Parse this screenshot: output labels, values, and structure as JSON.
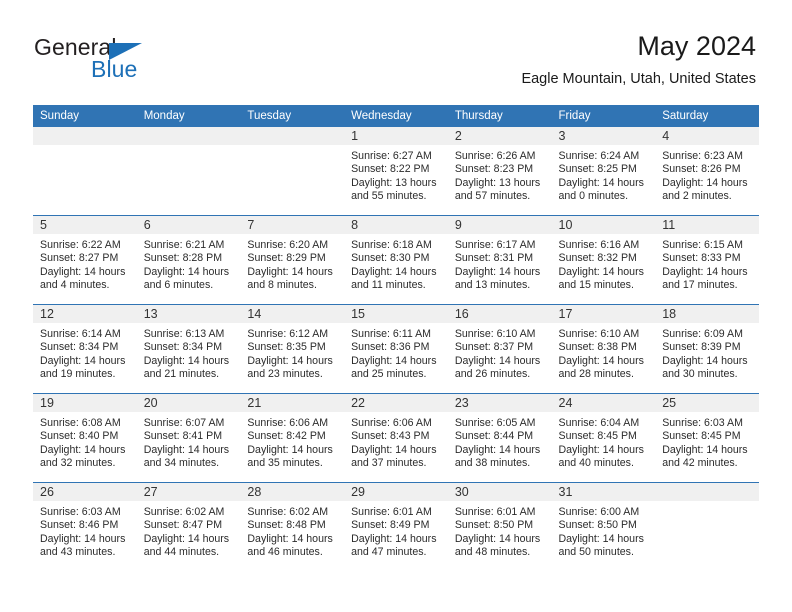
{
  "brand": {
    "name_top": "General",
    "name_bottom": "Blue",
    "triangle_color": "#1d70b7",
    "text_color": "#231f20"
  },
  "header": {
    "title": "May 2024",
    "subtitle": "Eagle Mountain, Utah, United States"
  },
  "theme": {
    "accent": "#3074b4",
    "daynum_band": "#f0f0f0",
    "cell_background": "#ffffff",
    "header_text": "#ffffff"
  },
  "calendar": {
    "weekday_headers": [
      "Sunday",
      "Monday",
      "Tuesday",
      "Wednesday",
      "Thursday",
      "Friday",
      "Saturday"
    ],
    "weeks": [
      [
        {
          "day": "",
          "sunrise": "",
          "sunset": "",
          "daylight_line1": "",
          "daylight_line2": ""
        },
        {
          "day": "",
          "sunrise": "",
          "sunset": "",
          "daylight_line1": "",
          "daylight_line2": ""
        },
        {
          "day": "",
          "sunrise": "",
          "sunset": "",
          "daylight_line1": "",
          "daylight_line2": ""
        },
        {
          "day": "1",
          "sunrise": "Sunrise: 6:27 AM",
          "sunset": "Sunset: 8:22 PM",
          "daylight_line1": "Daylight: 13 hours",
          "daylight_line2": "and 55 minutes."
        },
        {
          "day": "2",
          "sunrise": "Sunrise: 6:26 AM",
          "sunset": "Sunset: 8:23 PM",
          "daylight_line1": "Daylight: 13 hours",
          "daylight_line2": "and 57 minutes."
        },
        {
          "day": "3",
          "sunrise": "Sunrise: 6:24 AM",
          "sunset": "Sunset: 8:25 PM",
          "daylight_line1": "Daylight: 14 hours",
          "daylight_line2": "and 0 minutes."
        },
        {
          "day": "4",
          "sunrise": "Sunrise: 6:23 AM",
          "sunset": "Sunset: 8:26 PM",
          "daylight_line1": "Daylight: 14 hours",
          "daylight_line2": "and 2 minutes."
        }
      ],
      [
        {
          "day": "5",
          "sunrise": "Sunrise: 6:22 AM",
          "sunset": "Sunset: 8:27 PM",
          "daylight_line1": "Daylight: 14 hours",
          "daylight_line2": "and 4 minutes."
        },
        {
          "day": "6",
          "sunrise": "Sunrise: 6:21 AM",
          "sunset": "Sunset: 8:28 PM",
          "daylight_line1": "Daylight: 14 hours",
          "daylight_line2": "and 6 minutes."
        },
        {
          "day": "7",
          "sunrise": "Sunrise: 6:20 AM",
          "sunset": "Sunset: 8:29 PM",
          "daylight_line1": "Daylight: 14 hours",
          "daylight_line2": "and 8 minutes."
        },
        {
          "day": "8",
          "sunrise": "Sunrise: 6:18 AM",
          "sunset": "Sunset: 8:30 PM",
          "daylight_line1": "Daylight: 14 hours",
          "daylight_line2": "and 11 minutes."
        },
        {
          "day": "9",
          "sunrise": "Sunrise: 6:17 AM",
          "sunset": "Sunset: 8:31 PM",
          "daylight_line1": "Daylight: 14 hours",
          "daylight_line2": "and 13 minutes."
        },
        {
          "day": "10",
          "sunrise": "Sunrise: 6:16 AM",
          "sunset": "Sunset: 8:32 PM",
          "daylight_line1": "Daylight: 14 hours",
          "daylight_line2": "and 15 minutes."
        },
        {
          "day": "11",
          "sunrise": "Sunrise: 6:15 AM",
          "sunset": "Sunset: 8:33 PM",
          "daylight_line1": "Daylight: 14 hours",
          "daylight_line2": "and 17 minutes."
        }
      ],
      [
        {
          "day": "12",
          "sunrise": "Sunrise: 6:14 AM",
          "sunset": "Sunset: 8:34 PM",
          "daylight_line1": "Daylight: 14 hours",
          "daylight_line2": "and 19 minutes."
        },
        {
          "day": "13",
          "sunrise": "Sunrise: 6:13 AM",
          "sunset": "Sunset: 8:34 PM",
          "daylight_line1": "Daylight: 14 hours",
          "daylight_line2": "and 21 minutes."
        },
        {
          "day": "14",
          "sunrise": "Sunrise: 6:12 AM",
          "sunset": "Sunset: 8:35 PM",
          "daylight_line1": "Daylight: 14 hours",
          "daylight_line2": "and 23 minutes."
        },
        {
          "day": "15",
          "sunrise": "Sunrise: 6:11 AM",
          "sunset": "Sunset: 8:36 PM",
          "daylight_line1": "Daylight: 14 hours",
          "daylight_line2": "and 25 minutes."
        },
        {
          "day": "16",
          "sunrise": "Sunrise: 6:10 AM",
          "sunset": "Sunset: 8:37 PM",
          "daylight_line1": "Daylight: 14 hours",
          "daylight_line2": "and 26 minutes."
        },
        {
          "day": "17",
          "sunrise": "Sunrise: 6:10 AM",
          "sunset": "Sunset: 8:38 PM",
          "daylight_line1": "Daylight: 14 hours",
          "daylight_line2": "and 28 minutes."
        },
        {
          "day": "18",
          "sunrise": "Sunrise: 6:09 AM",
          "sunset": "Sunset: 8:39 PM",
          "daylight_line1": "Daylight: 14 hours",
          "daylight_line2": "and 30 minutes."
        }
      ],
      [
        {
          "day": "19",
          "sunrise": "Sunrise: 6:08 AM",
          "sunset": "Sunset: 8:40 PM",
          "daylight_line1": "Daylight: 14 hours",
          "daylight_line2": "and 32 minutes."
        },
        {
          "day": "20",
          "sunrise": "Sunrise: 6:07 AM",
          "sunset": "Sunset: 8:41 PM",
          "daylight_line1": "Daylight: 14 hours",
          "daylight_line2": "and 34 minutes."
        },
        {
          "day": "21",
          "sunrise": "Sunrise: 6:06 AM",
          "sunset": "Sunset: 8:42 PM",
          "daylight_line1": "Daylight: 14 hours",
          "daylight_line2": "and 35 minutes."
        },
        {
          "day": "22",
          "sunrise": "Sunrise: 6:06 AM",
          "sunset": "Sunset: 8:43 PM",
          "daylight_line1": "Daylight: 14 hours",
          "daylight_line2": "and 37 minutes."
        },
        {
          "day": "23",
          "sunrise": "Sunrise: 6:05 AM",
          "sunset": "Sunset: 8:44 PM",
          "daylight_line1": "Daylight: 14 hours",
          "daylight_line2": "and 38 minutes."
        },
        {
          "day": "24",
          "sunrise": "Sunrise: 6:04 AM",
          "sunset": "Sunset: 8:45 PM",
          "daylight_line1": "Daylight: 14 hours",
          "daylight_line2": "and 40 minutes."
        },
        {
          "day": "25",
          "sunrise": "Sunrise: 6:03 AM",
          "sunset": "Sunset: 8:45 PM",
          "daylight_line1": "Daylight: 14 hours",
          "daylight_line2": "and 42 minutes."
        }
      ],
      [
        {
          "day": "26",
          "sunrise": "Sunrise: 6:03 AM",
          "sunset": "Sunset: 8:46 PM",
          "daylight_line1": "Daylight: 14 hours",
          "daylight_line2": "and 43 minutes."
        },
        {
          "day": "27",
          "sunrise": "Sunrise: 6:02 AM",
          "sunset": "Sunset: 8:47 PM",
          "daylight_line1": "Daylight: 14 hours",
          "daylight_line2": "and 44 minutes."
        },
        {
          "day": "28",
          "sunrise": "Sunrise: 6:02 AM",
          "sunset": "Sunset: 8:48 PM",
          "daylight_line1": "Daylight: 14 hours",
          "daylight_line2": "and 46 minutes."
        },
        {
          "day": "29",
          "sunrise": "Sunrise: 6:01 AM",
          "sunset": "Sunset: 8:49 PM",
          "daylight_line1": "Daylight: 14 hours",
          "daylight_line2": "and 47 minutes."
        },
        {
          "day": "30",
          "sunrise": "Sunrise: 6:01 AM",
          "sunset": "Sunset: 8:50 PM",
          "daylight_line1": "Daylight: 14 hours",
          "daylight_line2": "and 48 minutes."
        },
        {
          "day": "31",
          "sunrise": "Sunrise: 6:00 AM",
          "sunset": "Sunset: 8:50 PM",
          "daylight_line1": "Daylight: 14 hours",
          "daylight_line2": "and 50 minutes."
        },
        {
          "day": "",
          "sunrise": "",
          "sunset": "",
          "daylight_line1": "",
          "daylight_line2": ""
        }
      ]
    ]
  }
}
